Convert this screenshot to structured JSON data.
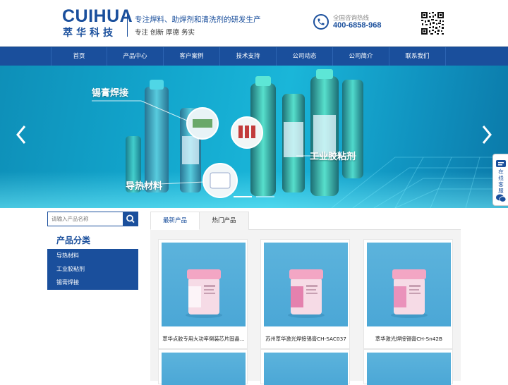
{
  "header": {
    "logo_en": "CUIHUA",
    "logo_cn": "萃华科技",
    "slogan_line1": "专注焊料、助焊剂和清洗剂的研发生产",
    "slogan_line2": "专注 创新 厚德 务实",
    "hotline_label": "全国咨询热线",
    "hotline_number": "400-6858-968"
  },
  "nav": {
    "items": [
      "首页",
      "产品中心",
      "客户案例",
      "技术支持",
      "公司动态",
      "公司简介",
      "联系我们"
    ]
  },
  "banner": {
    "labels": [
      "锡膏焊接",
      "工业胶粘剂",
      "导热材料"
    ],
    "active_slide": 1,
    "slide_count": 2
  },
  "side_tools": {
    "online_service": "在线客服"
  },
  "sidebar": {
    "search_placeholder": "请输入产品名称",
    "category_title": "产品分类",
    "categories": [
      "导热材料",
      "工业胶粘剂",
      "锡膏焊接"
    ]
  },
  "products": {
    "tabs": [
      "最新产品",
      "热门产品"
    ],
    "active_tab": 0,
    "items": [
      {
        "name": "萃华点胶专用大功率倒装芯片固晶..."
      },
      {
        "name": "苏州萃华激光焊接锡膏CH-SAC037"
      },
      {
        "name": "萃华激光焊接锡膏CH-Sn42B"
      }
    ]
  },
  "colors": {
    "brand_blue": "#1a4f9c",
    "banner_cyan": "#12a5cc",
    "product_bg": "#4ba7d6"
  }
}
